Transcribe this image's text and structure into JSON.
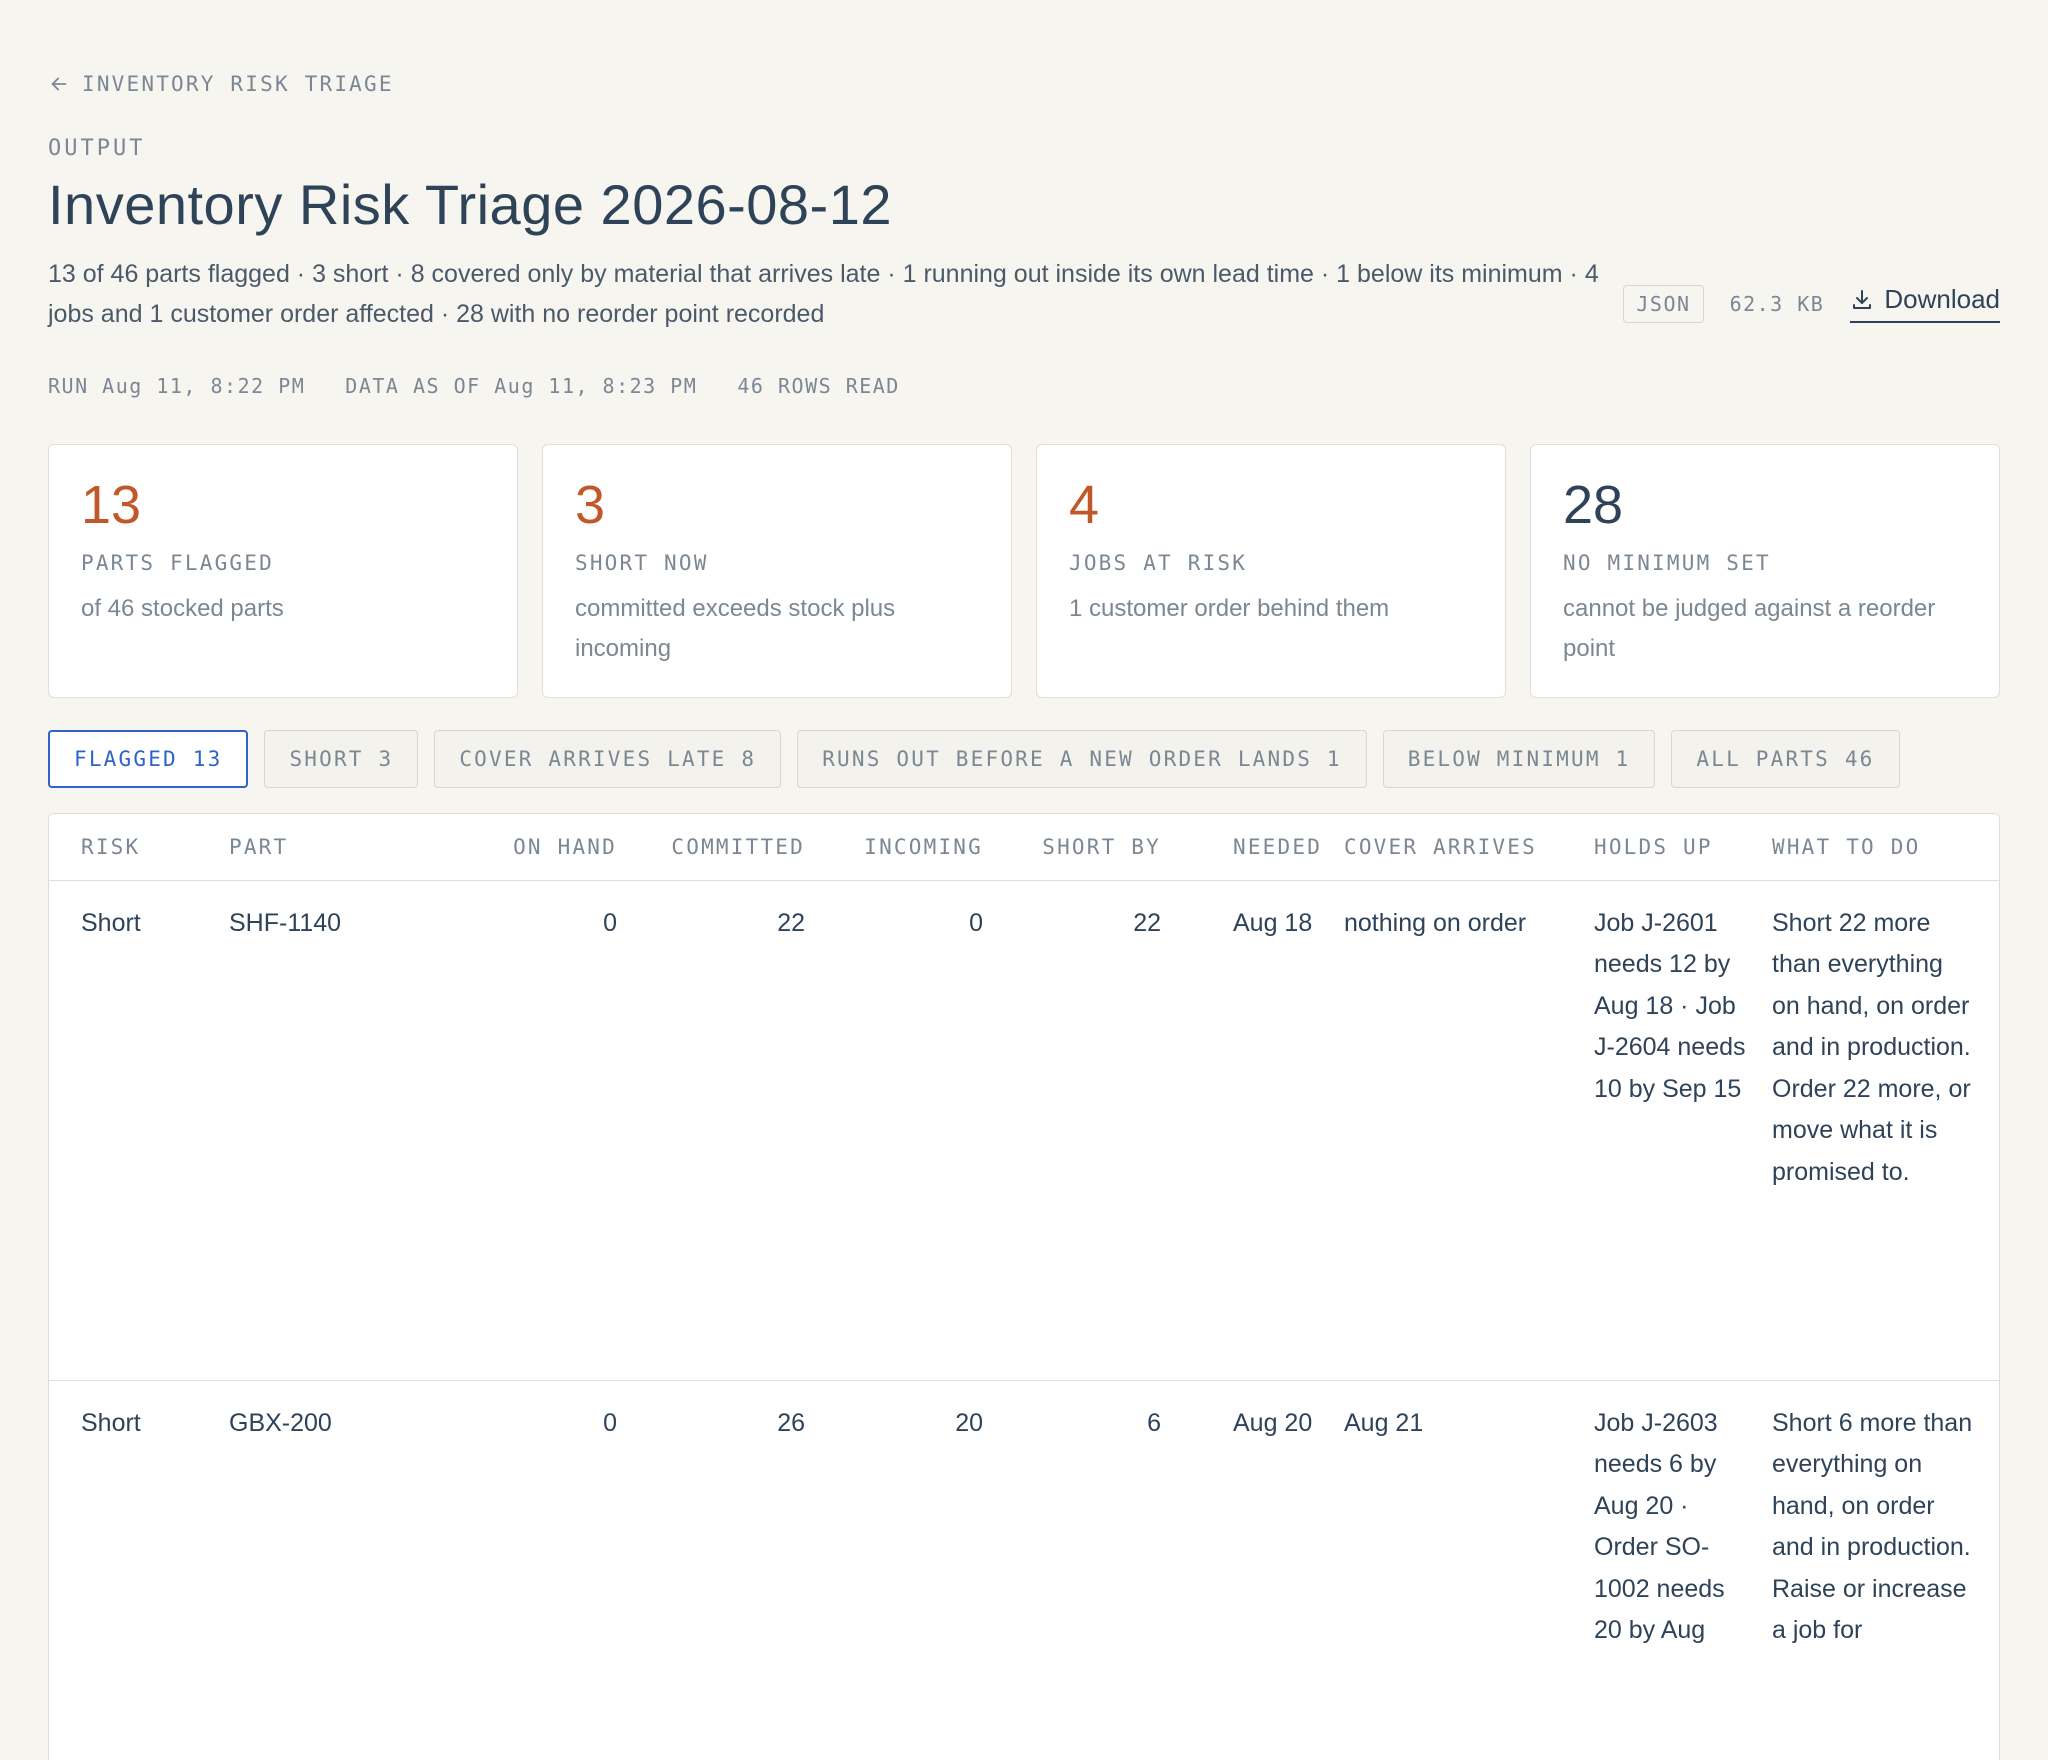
{
  "nav": {
    "back_label": "INVENTORY RISK TRIAGE"
  },
  "header": {
    "eyebrow": "OUTPUT",
    "title": "Inventory Risk Triage 2026-08-12",
    "summary": "13 of 46 parts flagged · 3 short · 8 covered only by material that arrives late · 1 running out inside its own lead time · 1 below its minimum · 4 jobs and 1 customer order affected · 28 with no reorder point recorded",
    "format_badge": "JSON",
    "file_size": "62.3 KB",
    "download_label": "Download"
  },
  "meta": {
    "run": "RUN Aug 11, 8:22 PM",
    "data_as_of": "DATA AS OF Aug 11, 8:23 PM",
    "rows_read": "46 ROWS READ"
  },
  "cards": [
    {
      "value": "13",
      "label": "PARTS FLAGGED",
      "desc": "of 46 stocked parts"
    },
    {
      "value": "3",
      "label": "SHORT NOW",
      "desc": "committed exceeds stock plus incoming"
    },
    {
      "value": "4",
      "label": "JOBS AT RISK",
      "desc": "1 customer order behind them"
    },
    {
      "value": "28",
      "label": "NO MINIMUM SET",
      "desc": "cannot be judged against a reorder point"
    }
  ],
  "filters": [
    {
      "label": "FLAGGED 13",
      "active": true
    },
    {
      "label": "SHORT 3",
      "active": false
    },
    {
      "label": "COVER ARRIVES LATE 8",
      "active": false
    },
    {
      "label": "RUNS OUT BEFORE A NEW ORDER LANDS 1",
      "active": false
    },
    {
      "label": "BELOW MINIMUM 1",
      "active": false
    },
    {
      "label": "ALL PARTS 46",
      "active": false
    }
  ],
  "table": {
    "columns": {
      "risk": "RISK",
      "part": "PART",
      "on_hand": "ON HAND",
      "committed": "COMMITTED",
      "incoming": "INCOMING",
      "short_by": "SHORT BY",
      "needed": "NEEDED",
      "cover_arrives": "COVER ARRIVES",
      "holds_up": "HOLDS UP",
      "what_to_do": "WHAT TO DO"
    },
    "rows": [
      {
        "risk": "Short",
        "part": "SHF-1140",
        "on_hand": "0",
        "committed": "22",
        "incoming": "0",
        "short_by": "22",
        "needed": "Aug 18",
        "cover_arrives": "nothing on order",
        "holds_up": "Job J-2601 needs 12 by Aug 18 · Job J-2604 needs 10 by Sep 15",
        "what_to_do": "Short 22 more than everything on hand, on order and in production. Order 22 more, or move what it is promised to."
      },
      {
        "risk": "Short",
        "part": "GBX-200",
        "on_hand": "0",
        "committed": "26",
        "incoming": "20",
        "short_by": "6",
        "needed": "Aug 20",
        "cover_arrives": "Aug 21",
        "holds_up": "Job J-2603 needs 6 by Aug 20 · Order SO-1002 needs 20 by Aug",
        "what_to_do": "Short 6 more than everything on hand, on order and in production. Raise or increase a job for"
      }
    ]
  }
}
